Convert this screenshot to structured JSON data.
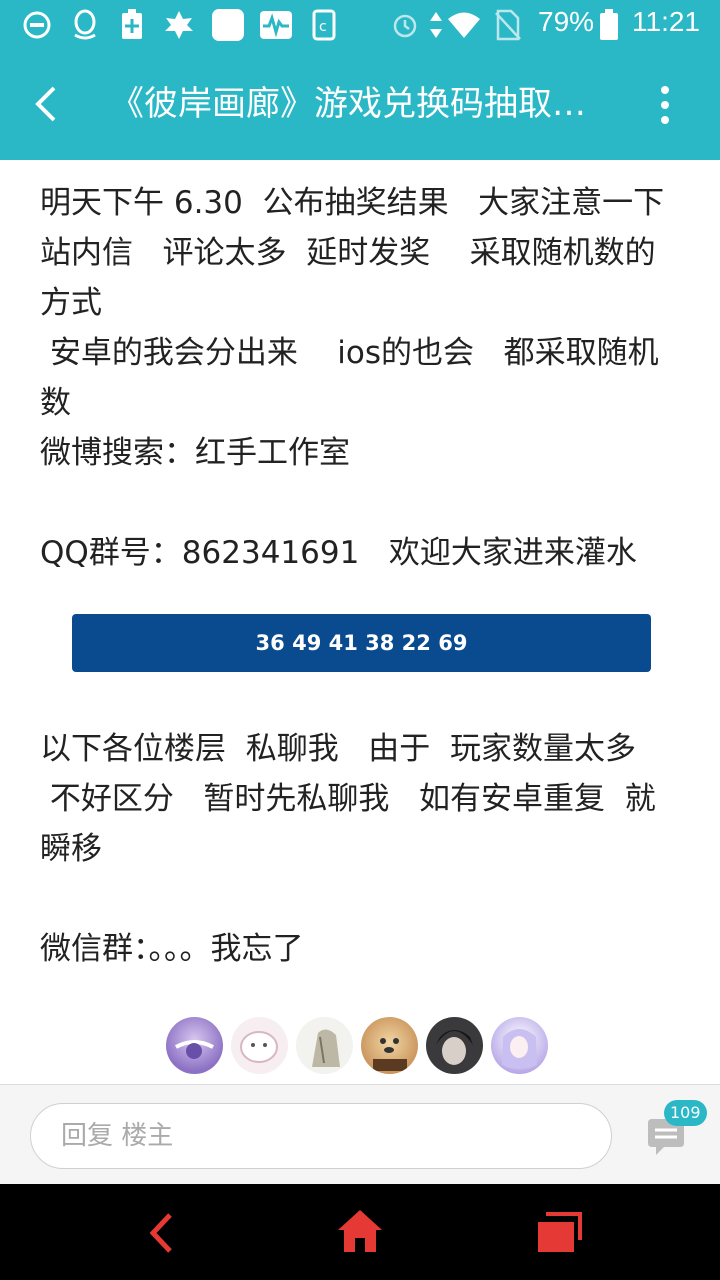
{
  "status_bar": {
    "battery_percent": "79%",
    "time": "11:21"
  },
  "header": {
    "title": "《彼岸画廊》游戏兑换码抽取…"
  },
  "post": {
    "line1": "明天下午 6.30  公布抽奖结果   大家注意一下",
    "line2": "站内信   评论太多  延时发奖    采取随机数的",
    "line3": "方式",
    "line4": " 安卓的我会分出来    ios的也会   都采取随机",
    "line5": "数",
    "line6": "微博搜索：红手工作室",
    "line7": "QQ群号：862341691   欢迎大家进来灌水",
    "numbers_banner": "36 49 41 38 22 69",
    "line8": "以下各位楼层  私聊我   由于  玩家数量太多",
    "line9": " 不好区分   暂时先私聊我   如有安卓重复  就",
    "line10": "瞬移",
    "line11": "微信群：。。。我忘了"
  },
  "reply": {
    "placeholder": "回复  楼主",
    "comment_count": "109"
  },
  "colors": {
    "accent": "#2ab7c6",
    "banner": "#0a4a8f",
    "nav_icon": "#e53935"
  }
}
